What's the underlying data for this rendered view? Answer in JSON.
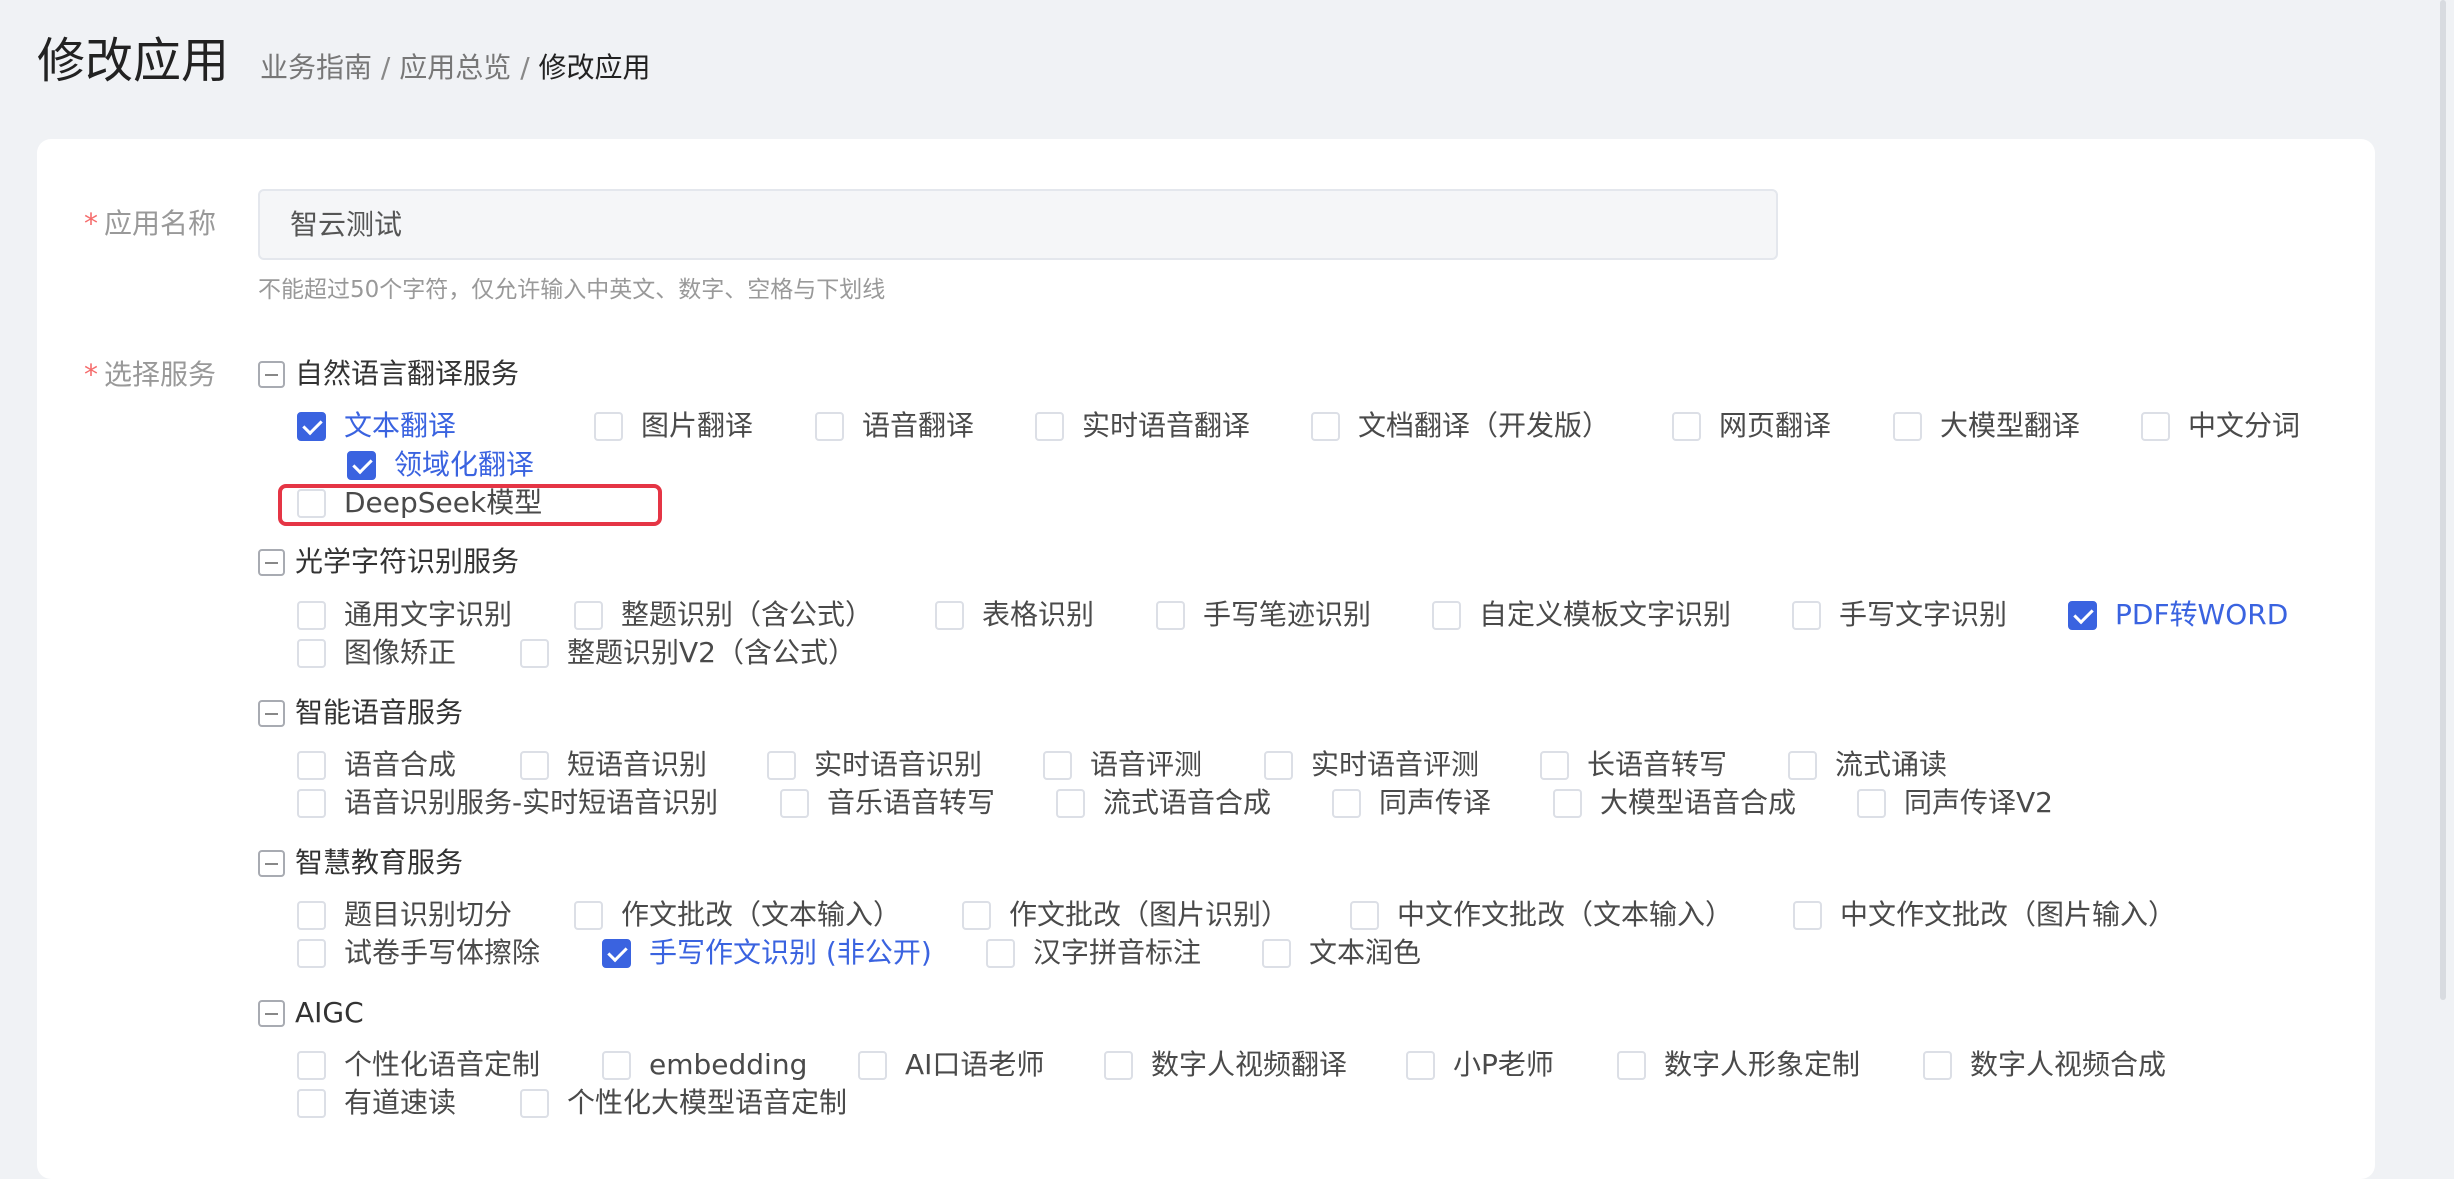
{
  "header": {
    "title": "修改应用",
    "breadcrumb": [
      "业务指南",
      "应用总览",
      "修改应用"
    ],
    "separator": "/"
  },
  "form": {
    "app_name": {
      "label": "应用名称",
      "required_mark": "*",
      "value": "智云测试",
      "hint": "不能超过50个字符，仅允许输入中英文、数字、空格与下划线"
    },
    "services": {
      "label": "选择服务",
      "required_mark": "*",
      "groups": [
        {
          "name": "自然语言翻译服务",
          "items": [
            {
              "label": "文本翻译",
              "checked": true
            },
            {
              "label": "图片翻译",
              "checked": false
            },
            {
              "label": "语音翻译",
              "checked": false
            },
            {
              "label": "实时语音翻译",
              "checked": false
            },
            {
              "label": "文档翻译（开发版）",
              "checked": false
            },
            {
              "label": "网页翻译",
              "checked": false
            },
            {
              "label": "大模型翻译",
              "checked": false
            },
            {
              "label": "中文分词",
              "checked": false
            },
            {
              "label": "领域化翻译",
              "checked": true
            },
            {
              "label": "DeepSeek模型",
              "checked": false
            }
          ]
        },
        {
          "name": "光学字符识别服务",
          "items": [
            {
              "label": "通用文字识别",
              "checked": false
            },
            {
              "label": "整题识别（含公式）",
              "checked": false
            },
            {
              "label": "表格识别",
              "checked": false
            },
            {
              "label": "手写笔迹识别",
              "checked": false
            },
            {
              "label": "自定义模板文字识别",
              "checked": false
            },
            {
              "label": "手写文字识别",
              "checked": false
            },
            {
              "label": "PDF转WORD",
              "checked": true
            },
            {
              "label": "图像矫正",
              "checked": false
            },
            {
              "label": "整题识别V2（含公式）",
              "checked": false
            }
          ]
        },
        {
          "name": "智能语音服务",
          "items": [
            {
              "label": "语音合成",
              "checked": false
            },
            {
              "label": "短语音识别",
              "checked": false
            },
            {
              "label": "实时语音识别",
              "checked": false
            },
            {
              "label": "语音评测",
              "checked": false
            },
            {
              "label": "实时语音评测",
              "checked": false
            },
            {
              "label": "长语音转写",
              "checked": false
            },
            {
              "label": "流式诵读",
              "checked": false
            },
            {
              "label": "语音识别服务-实时短语音识别",
              "checked": false
            },
            {
              "label": "音乐语音转写",
              "checked": false
            },
            {
              "label": "流式语音合成",
              "checked": false
            },
            {
              "label": "同声传译",
              "checked": false
            },
            {
              "label": "大模型语音合成",
              "checked": false
            },
            {
              "label": "同声传译V2",
              "checked": false
            }
          ]
        },
        {
          "name": "智慧教育服务",
          "items": [
            {
              "label": "题目识别切分",
              "checked": false
            },
            {
              "label": "作文批改（文本输入）",
              "checked": false
            },
            {
              "label": "作文批改（图片识别）",
              "checked": false
            },
            {
              "label": "中文作文批改（文本输入）",
              "checked": false
            },
            {
              "label": "中文作文批改（图片输入）",
              "checked": false
            },
            {
              "label": "试卷手写体擦除",
              "checked": false
            },
            {
              "label": "手写作文识别 (非公开)",
              "checked": true
            },
            {
              "label": "汉字拼音标注",
              "checked": false
            },
            {
              "label": "文本润色",
              "checked": false
            }
          ]
        },
        {
          "name": "AIGC",
          "items": [
            {
              "label": "个性化语音定制",
              "checked": false
            },
            {
              "label": "embedding",
              "checked": false
            },
            {
              "label": "AI口语老师",
              "checked": false
            },
            {
              "label": "数字人视频翻译",
              "checked": false
            },
            {
              "label": "小P老师",
              "checked": false
            },
            {
              "label": "数字人形象定制",
              "checked": false
            },
            {
              "label": "数字人视频合成",
              "checked": false
            },
            {
              "label": "有道速读",
              "checked": false
            },
            {
              "label": "个性化大模型语音定制",
              "checked": false
            }
          ]
        }
      ]
    }
  },
  "colors": {
    "accent": "#3a63e0",
    "required": "#f56c6c",
    "highlight": "#e53545"
  }
}
